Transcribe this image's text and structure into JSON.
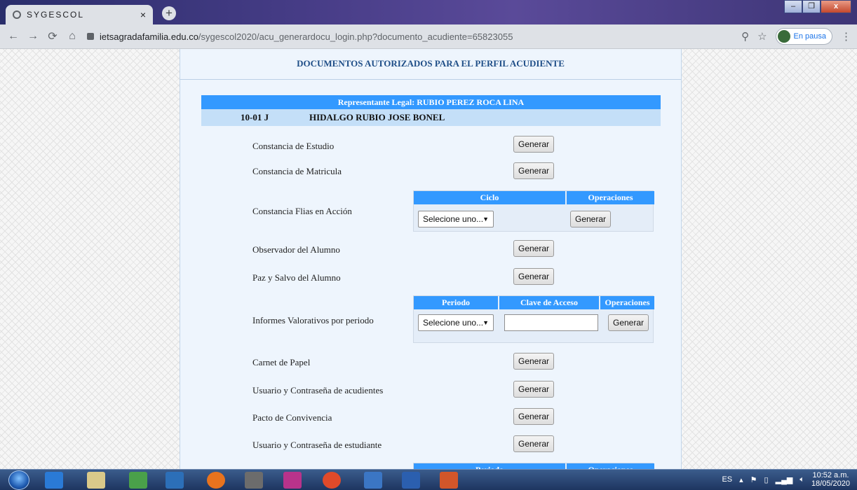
{
  "browser": {
    "tab_title": "SYGESCOL",
    "tab_close": "×",
    "new_tab": "+",
    "url_host": "ietsagradafamilia.edu.co",
    "url_path": "/sygescol2020/acu_generardocu_login.php?documento_acudiente=65823055",
    "profile_label": "En pausa",
    "min_label": "–",
    "max_label": "❐",
    "close_label": "x"
  },
  "page": {
    "heading": "DOCUMENTOS AUTORIZADOS PARA EL PERFIL ACUDIENTE",
    "representative": "Representante Legal: RUBIO PEREZ ROCA LINA",
    "student_course": "10-01 J",
    "student_name": "HIDALGO RUBIO JOSE BONEL",
    "generate_label": "Generar",
    "select_placeholder": "Selecione uno...",
    "documents": [
      "Constancia de Estudio",
      "Constancia de Matricula",
      "Constancia Flias en Acción",
      "Observador del Alumno",
      "Paz y Salvo del Alumno",
      "Informes Valorativos por periodo",
      "Carnet de Papel",
      "Usuario y Contraseña de acudientes",
      "Pacto de Convivencia",
      "Usuario y Contraseña de estudiante"
    ],
    "flias_table": {
      "col1": "Ciclo",
      "col2": "Operaciones"
    },
    "informes_table": {
      "col1": "Periodo",
      "col2": "Clave de Acceso",
      "col3": "Operaciones"
    },
    "last_table": {
      "col1": "Periodo",
      "col2": "Operaciones"
    }
  },
  "taskbar": {
    "lang": "ES",
    "time": "10:52 a.m.",
    "date": "18/05/2020"
  },
  "colors": {
    "header_blue": "#3399ff",
    "student_row": "#c4dff8",
    "panel_bg": "#eef5fd",
    "heading_text": "#1f4e87"
  }
}
